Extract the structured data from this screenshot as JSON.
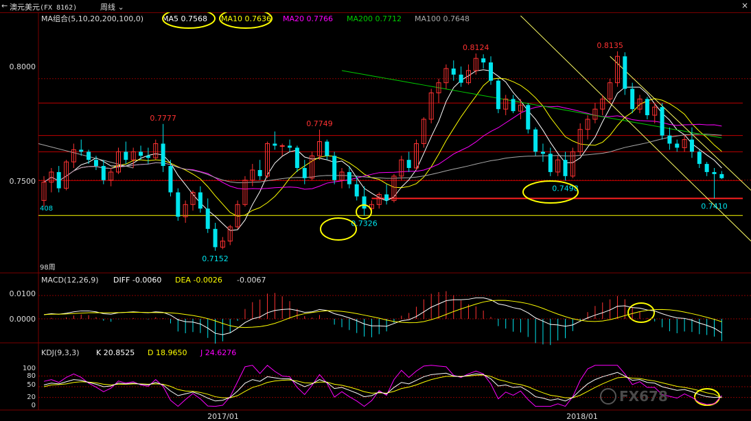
{
  "header": {
    "back_icon": "back-arrow-icon",
    "instrument": "澳元美元",
    "code": "(FX 8162)",
    "period": "周线",
    "close_icon": "close-icon"
  },
  "colors": {
    "up": "#ff3232",
    "down": "#00e5ee",
    "ma5": "#ffffff",
    "ma10": "#ffff00",
    "ma20": "#ff00ff",
    "ma200": "#00cc00",
    "ma100": "#aaaaaa",
    "kdj_k": "#ffffff",
    "kdj_d": "#ffff00",
    "kdj_j": "#ff00ff"
  },
  "price_panel": {
    "legend": {
      "name": "MA组合(5,10,20,200,100,0)",
      "ma5": "MA5 0.7568",
      "ma10": "MA10 0.7636",
      "ma20": "MA20 0.7766",
      "ma200": "MA200 0.7712",
      "ma100": "MA100 0.7648"
    },
    "y_ticks": [
      "0.8000",
      "0.7500"
    ],
    "left_marker": "408",
    "bottom_label": "98周",
    "annotations": [
      "0.7777",
      "0.7749",
      "0.8124",
      "0.8135",
      "0.7152",
      "0.7326",
      "0.7498",
      "0.7410"
    ]
  },
  "macd_panel": {
    "name": "MACD(12,26,9)",
    "diff": "DIFF -0.0060",
    "dea": "DEA -0.0026",
    "macd": "-0.0067",
    "y_ticks": [
      "0.0100",
      "0.0000"
    ]
  },
  "kdj_panel": {
    "name": "KDJ(9,3,3)",
    "k": "K 20.8525",
    "d": "D 18.9650",
    "j": "J 24.6276",
    "y_ticks": [
      "100",
      "80",
      "50",
      "20",
      "0"
    ]
  },
  "x_axis": {
    "labels": [
      "2017/01",
      "2018/01"
    ]
  },
  "watermark": "FX678",
  "chart_data": {
    "type": "candlestick",
    "title": "澳元美元 周线",
    "ylim": [
      0.705,
      0.832
    ],
    "start_index": 0,
    "bars": [
      [
        0.74,
        0.752,
        0.737,
        0.749
      ],
      [
        0.749,
        0.756,
        0.744,
        0.754
      ],
      [
        0.754,
        0.757,
        0.744,
        0.746
      ],
      [
        0.746,
        0.76,
        0.745,
        0.759
      ],
      [
        0.759,
        0.768,
        0.756,
        0.765
      ],
      [
        0.765,
        0.77,
        0.762,
        0.764
      ],
      [
        0.764,
        0.765,
        0.758,
        0.76
      ],
      [
        0.76,
        0.762,
        0.755,
        0.757
      ],
      [
        0.757,
        0.76,
        0.748,
        0.75
      ],
      [
        0.75,
        0.756,
        0.747,
        0.754
      ],
      [
        0.754,
        0.766,
        0.753,
        0.764
      ],
      [
        0.764,
        0.769,
        0.758,
        0.76
      ],
      [
        0.76,
        0.766,
        0.756,
        0.764
      ],
      [
        0.764,
        0.767,
        0.76,
        0.762
      ],
      [
        0.762,
        0.766,
        0.758,
        0.761
      ],
      [
        0.761,
        0.77,
        0.76,
        0.768
      ],
      [
        0.768,
        0.7777,
        0.754,
        0.757
      ],
      [
        0.757,
        0.76,
        0.742,
        0.744
      ],
      [
        0.744,
        0.746,
        0.73,
        0.732
      ],
      [
        0.732,
        0.74,
        0.729,
        0.738
      ],
      [
        0.738,
        0.745,
        0.735,
        0.744
      ],
      [
        0.744,
        0.747,
        0.734,
        0.736
      ],
      [
        0.736,
        0.741,
        0.724,
        0.726
      ],
      [
        0.726,
        0.729,
        0.7152,
        0.717
      ],
      [
        0.717,
        0.722,
        0.716,
        0.72
      ],
      [
        0.72,
        0.728,
        0.718,
        0.727
      ],
      [
        0.727,
        0.74,
        0.726,
        0.738
      ],
      [
        0.738,
        0.752,
        0.737,
        0.75
      ],
      [
        0.75,
        0.758,
        0.747,
        0.755
      ],
      [
        0.755,
        0.76,
        0.75,
        0.752
      ],
      [
        0.752,
        0.769,
        0.751,
        0.768
      ],
      [
        0.768,
        0.774,
        0.765,
        0.767
      ],
      [
        0.767,
        0.768,
        0.762,
        0.767
      ],
      [
        0.767,
        0.77,
        0.764,
        0.766
      ],
      [
        0.766,
        0.767,
        0.754,
        0.756
      ],
      [
        0.756,
        0.76,
        0.748,
        0.751
      ],
      [
        0.751,
        0.764,
        0.75,
        0.762
      ],
      [
        0.762,
        0.7749,
        0.76,
        0.769
      ],
      [
        0.769,
        0.77,
        0.76,
        0.762
      ],
      [
        0.762,
        0.764,
        0.748,
        0.75
      ],
      [
        0.75,
        0.756,
        0.746,
        0.754
      ],
      [
        0.754,
        0.757,
        0.746,
        0.748
      ],
      [
        0.748,
        0.752,
        0.74,
        0.742
      ],
      [
        0.742,
        0.747,
        0.7326,
        0.736
      ],
      [
        0.736,
        0.74,
        0.734,
        0.738
      ],
      [
        0.738,
        0.744,
        0.736,
        0.743
      ],
      [
        0.743,
        0.748,
        0.738,
        0.74
      ],
      [
        0.74,
        0.753,
        0.739,
        0.752
      ],
      [
        0.752,
        0.762,
        0.75,
        0.76
      ],
      [
        0.76,
        0.764,
        0.754,
        0.756
      ],
      [
        0.756,
        0.77,
        0.755,
        0.768
      ],
      [
        0.768,
        0.781,
        0.766,
        0.78
      ],
      [
        0.78,
        0.795,
        0.778,
        0.793
      ],
      [
        0.793,
        0.8,
        0.788,
        0.798
      ],
      [
        0.798,
        0.807,
        0.795,
        0.805
      ],
      [
        0.805,
        0.809,
        0.799,
        0.802
      ],
      [
        0.802,
        0.806,
        0.796,
        0.798
      ],
      [
        0.798,
        0.807,
        0.797,
        0.804
      ],
      [
        0.804,
        0.8124,
        0.802,
        0.81
      ],
      [
        0.81,
        0.812,
        0.805,
        0.808
      ],
      [
        0.808,
        0.811,
        0.797,
        0.799
      ],
      [
        0.799,
        0.8,
        0.783,
        0.785
      ],
      [
        0.785,
        0.792,
        0.782,
        0.79
      ],
      [
        0.79,
        0.792,
        0.783,
        0.784
      ],
      [
        0.784,
        0.79,
        0.78,
        0.787
      ],
      [
        0.787,
        0.788,
        0.773,
        0.775
      ],
      [
        0.775,
        0.776,
        0.762,
        0.764
      ],
      [
        0.764,
        0.768,
        0.759,
        0.763
      ],
      [
        0.763,
        0.766,
        0.752,
        0.754
      ],
      [
        0.754,
        0.762,
        0.752,
        0.76
      ],
      [
        0.76,
        0.764,
        0.7498,
        0.752
      ],
      [
        0.752,
        0.766,
        0.751,
        0.764
      ],
      [
        0.764,
        0.778,
        0.762,
        0.775
      ],
      [
        0.775,
        0.782,
        0.77,
        0.78
      ],
      [
        0.78,
        0.788,
        0.778,
        0.785
      ],
      [
        0.785,
        0.792,
        0.782,
        0.79
      ],
      [
        0.79,
        0.8,
        0.788,
        0.798
      ],
      [
        0.798,
        0.8135,
        0.796,
        0.811
      ],
      [
        0.811,
        0.813,
        0.792,
        0.795
      ],
      [
        0.795,
        0.798,
        0.783,
        0.785
      ],
      [
        0.785,
        0.792,
        0.783,
        0.79
      ],
      [
        0.79,
        0.791,
        0.78,
        0.782
      ],
      [
        0.782,
        0.788,
        0.778,
        0.786
      ],
      [
        0.786,
        0.788,
        0.77,
        0.772
      ],
      [
        0.772,
        0.776,
        0.765,
        0.768
      ],
      [
        0.768,
        0.77,
        0.764,
        0.766
      ],
      [
        0.766,
        0.772,
        0.764,
        0.77
      ],
      [
        0.77,
        0.776,
        0.761,
        0.764
      ],
      [
        0.764,
        0.765,
        0.756,
        0.758
      ],
      [
        0.758,
        0.759,
        0.752,
        0.754
      ],
      [
        0.754,
        0.756,
        0.741,
        0.753
      ],
      [
        0.753,
        0.7545,
        0.7505,
        0.751
      ]
    ],
    "hlines": [
      0.7326,
      0.741,
      0.7498,
      0.764,
      0.772,
      0.788
    ],
    "macd": [
      0.0018,
      0.0022,
      0.002,
      0.0024,
      0.003,
      0.0034,
      0.0034,
      0.003,
      0.0022,
      0.002,
      0.0026,
      0.0028,
      0.003,
      0.0028,
      0.0026,
      0.003,
      0.0028,
      0.0016,
      -0.0004,
      -0.0012,
      -0.0014,
      -0.0022,
      -0.004,
      -0.0062,
      -0.0068,
      -0.006,
      -0.004,
      -0.0016,
      0.0,
      0.0008,
      0.0026,
      0.0036,
      0.004,
      0.0042,
      0.0036,
      0.0028,
      0.003,
      0.004,
      0.0036,
      0.0022,
      0.0014,
      0.0004,
      -0.0008,
      -0.0022,
      -0.003,
      -0.003,
      -0.0032,
      -0.002,
      -0.0008,
      -0.0004,
      0.001,
      0.003,
      0.005,
      0.0064,
      0.0078,
      0.0082,
      0.0082,
      0.0084,
      0.009,
      0.009,
      0.0082,
      0.0064,
      0.0058,
      0.0048,
      0.0042,
      0.0026,
      0.0004,
      -0.001,
      -0.0024,
      -0.0026,
      -0.0032,
      -0.0026,
      -0.001,
      0.0004,
      0.0016,
      0.0026,
      0.0038,
      0.0054,
      0.0056,
      0.0048,
      0.0046,
      0.0038,
      0.0034,
      0.0022,
      0.0012,
      0.0004,
      0.0002,
      -0.0006,
      -0.0018,
      -0.0028,
      -0.004,
      -0.006
    ],
    "kdj_k": [
      55,
      60,
      58,
      64,
      70,
      68,
      62,
      57,
      50,
      52,
      60,
      58,
      60,
      57,
      55,
      62,
      55,
      38,
      25,
      30,
      35,
      28,
      18,
      10,
      12,
      20,
      38,
      60,
      70,
      65,
      78,
      75,
      72,
      72,
      60,
      50,
      58,
      70,
      62,
      45,
      48,
      40,
      32,
      22,
      25,
      35,
      30,
      48,
      62,
      58,
      68,
      78,
      84,
      86,
      88,
      80,
      78,
      82,
      86,
      84,
      72,
      52,
      55,
      48,
      50,
      38,
      22,
      18,
      12,
      16,
      10,
      20,
      40,
      58,
      70,
      78,
      84,
      90,
      80,
      68,
      70,
      62,
      60,
      50,
      45,
      40,
      42,
      36,
      28,
      22,
      20,
      21
    ],
    "kdj_d": [
      50,
      55,
      56,
      58,
      62,
      64,
      63,
      61,
      57,
      55,
      57,
      57,
      58,
      58,
      57,
      58,
      57,
      51,
      42,
      38,
      37,
      34,
      29,
      22,
      19,
      19,
      25,
      37,
      48,
      54,
      62,
      66,
      68,
      69,
      66,
      61,
      60,
      63,
      63,
      57,
      54,
      49,
      43,
      36,
      32,
      33,
      32,
      37,
      45,
      49,
      55,
      63,
      70,
      75,
      79,
      79,
      79,
      80,
      82,
      83,
      79,
      70,
      65,
      59,
      56,
      50,
      41,
      33,
      26,
      23,
      19,
      19,
      26,
      37,
      48,
      58,
      67,
      75,
      77,
      74,
      73,
      69,
      66,
      61,
      56,
      51,
      48,
      44,
      39,
      33,
      29,
      19
    ]
  }
}
